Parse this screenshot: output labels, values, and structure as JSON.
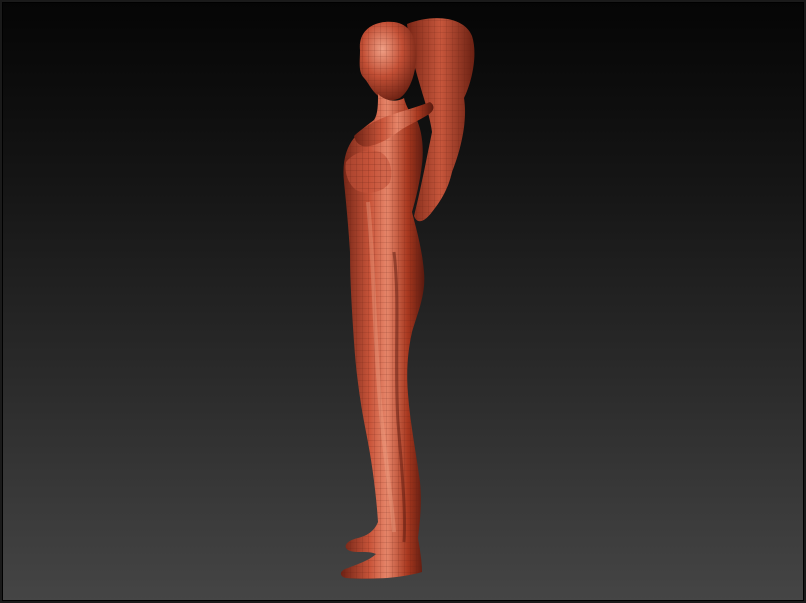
{
  "viewport": {
    "background_top": "#050505",
    "background_bottom": "#454545"
  },
  "model": {
    "material_base": "#b5412b",
    "material_highlight": "#e07a5c",
    "material_shadow": "#5c1c12",
    "wire_color": "#7a2818"
  }
}
